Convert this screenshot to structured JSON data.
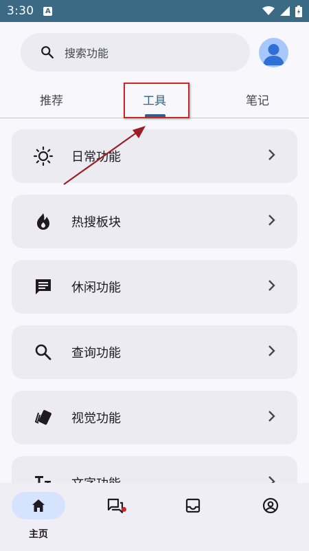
{
  "status_bar": {
    "time": "3:30",
    "notification_glyph": "A"
  },
  "search": {
    "placeholder": "搜索功能"
  },
  "tabs": [
    {
      "label": "推荐",
      "active": false
    },
    {
      "label": "工具",
      "active": true
    },
    {
      "label": "笔记",
      "active": false
    }
  ],
  "list": {
    "items": [
      {
        "label": "日常功能",
        "icon": "sun-icon"
      },
      {
        "label": "热搜板块",
        "icon": "flame-icon"
      },
      {
        "label": "休闲功能",
        "icon": "chat-icon"
      },
      {
        "label": "查询功能",
        "icon": "search-icon"
      },
      {
        "label": "视觉功能",
        "icon": "cards-icon"
      },
      {
        "label": "文字功能",
        "icon": "text-icon"
      }
    ]
  },
  "bottom_nav": {
    "items": [
      {
        "label": "主页",
        "icon": "home-icon",
        "active": true
      },
      {
        "label": "",
        "icon": "forum-icon",
        "active": false,
        "badge": true
      },
      {
        "label": "",
        "icon": "inbox-icon",
        "active": false
      },
      {
        "label": "",
        "icon": "account-icon",
        "active": false
      }
    ]
  },
  "colors": {
    "status_bar": "#3b6a85",
    "accent": "#2f5f8a",
    "annotation": "#c9262a",
    "card": "#ebebf1"
  }
}
